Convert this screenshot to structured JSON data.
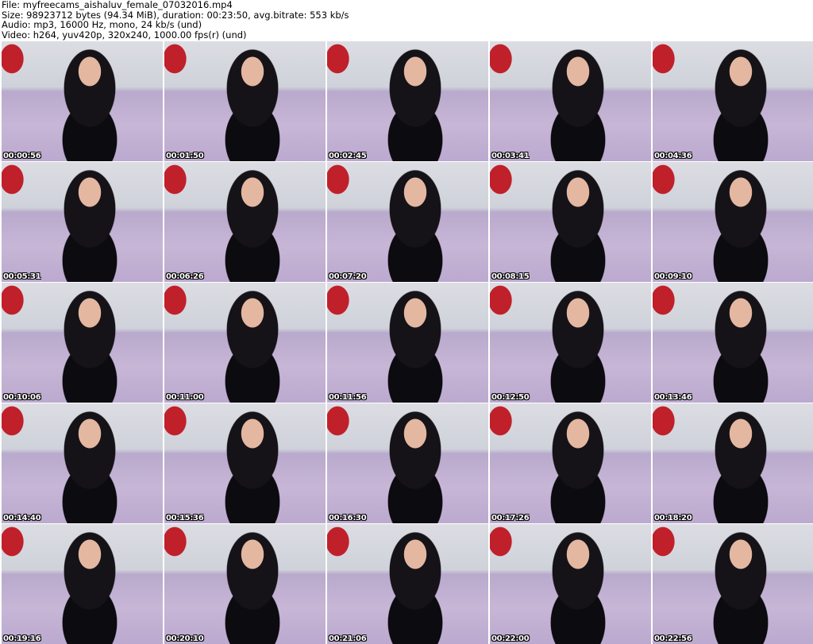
{
  "header": {
    "file": "File: myfreecams_aishaluv_female_07032016.mp4",
    "size": "Size: 98923712 bytes (94.34 MiB), duration: 00:23:50, avg.bitrate: 553 kb/s",
    "audio": "Audio: mp3, 16000 Hz, mono, 24 kb/s (und)",
    "video": "Video: h264, yuv420p, 320x240, 1000.00 fps(r) (und)"
  },
  "thumbnails": [
    "00:00:56",
    "00:01:50",
    "00:02:45",
    "00:03:41",
    "00:04:36",
    "00:05:31",
    "00:06:26",
    "00:07:20",
    "00:08:15",
    "00:09:10",
    "00:10:06",
    "00:11:00",
    "00:11:56",
    "00:12:50",
    "00:13:46",
    "00:14:40",
    "00:15:36",
    "00:16:30",
    "00:17:26",
    "00:18:20",
    "00:19:16",
    "00:20:10",
    "00:21:06",
    "00:22:00",
    "00:22:56"
  ]
}
